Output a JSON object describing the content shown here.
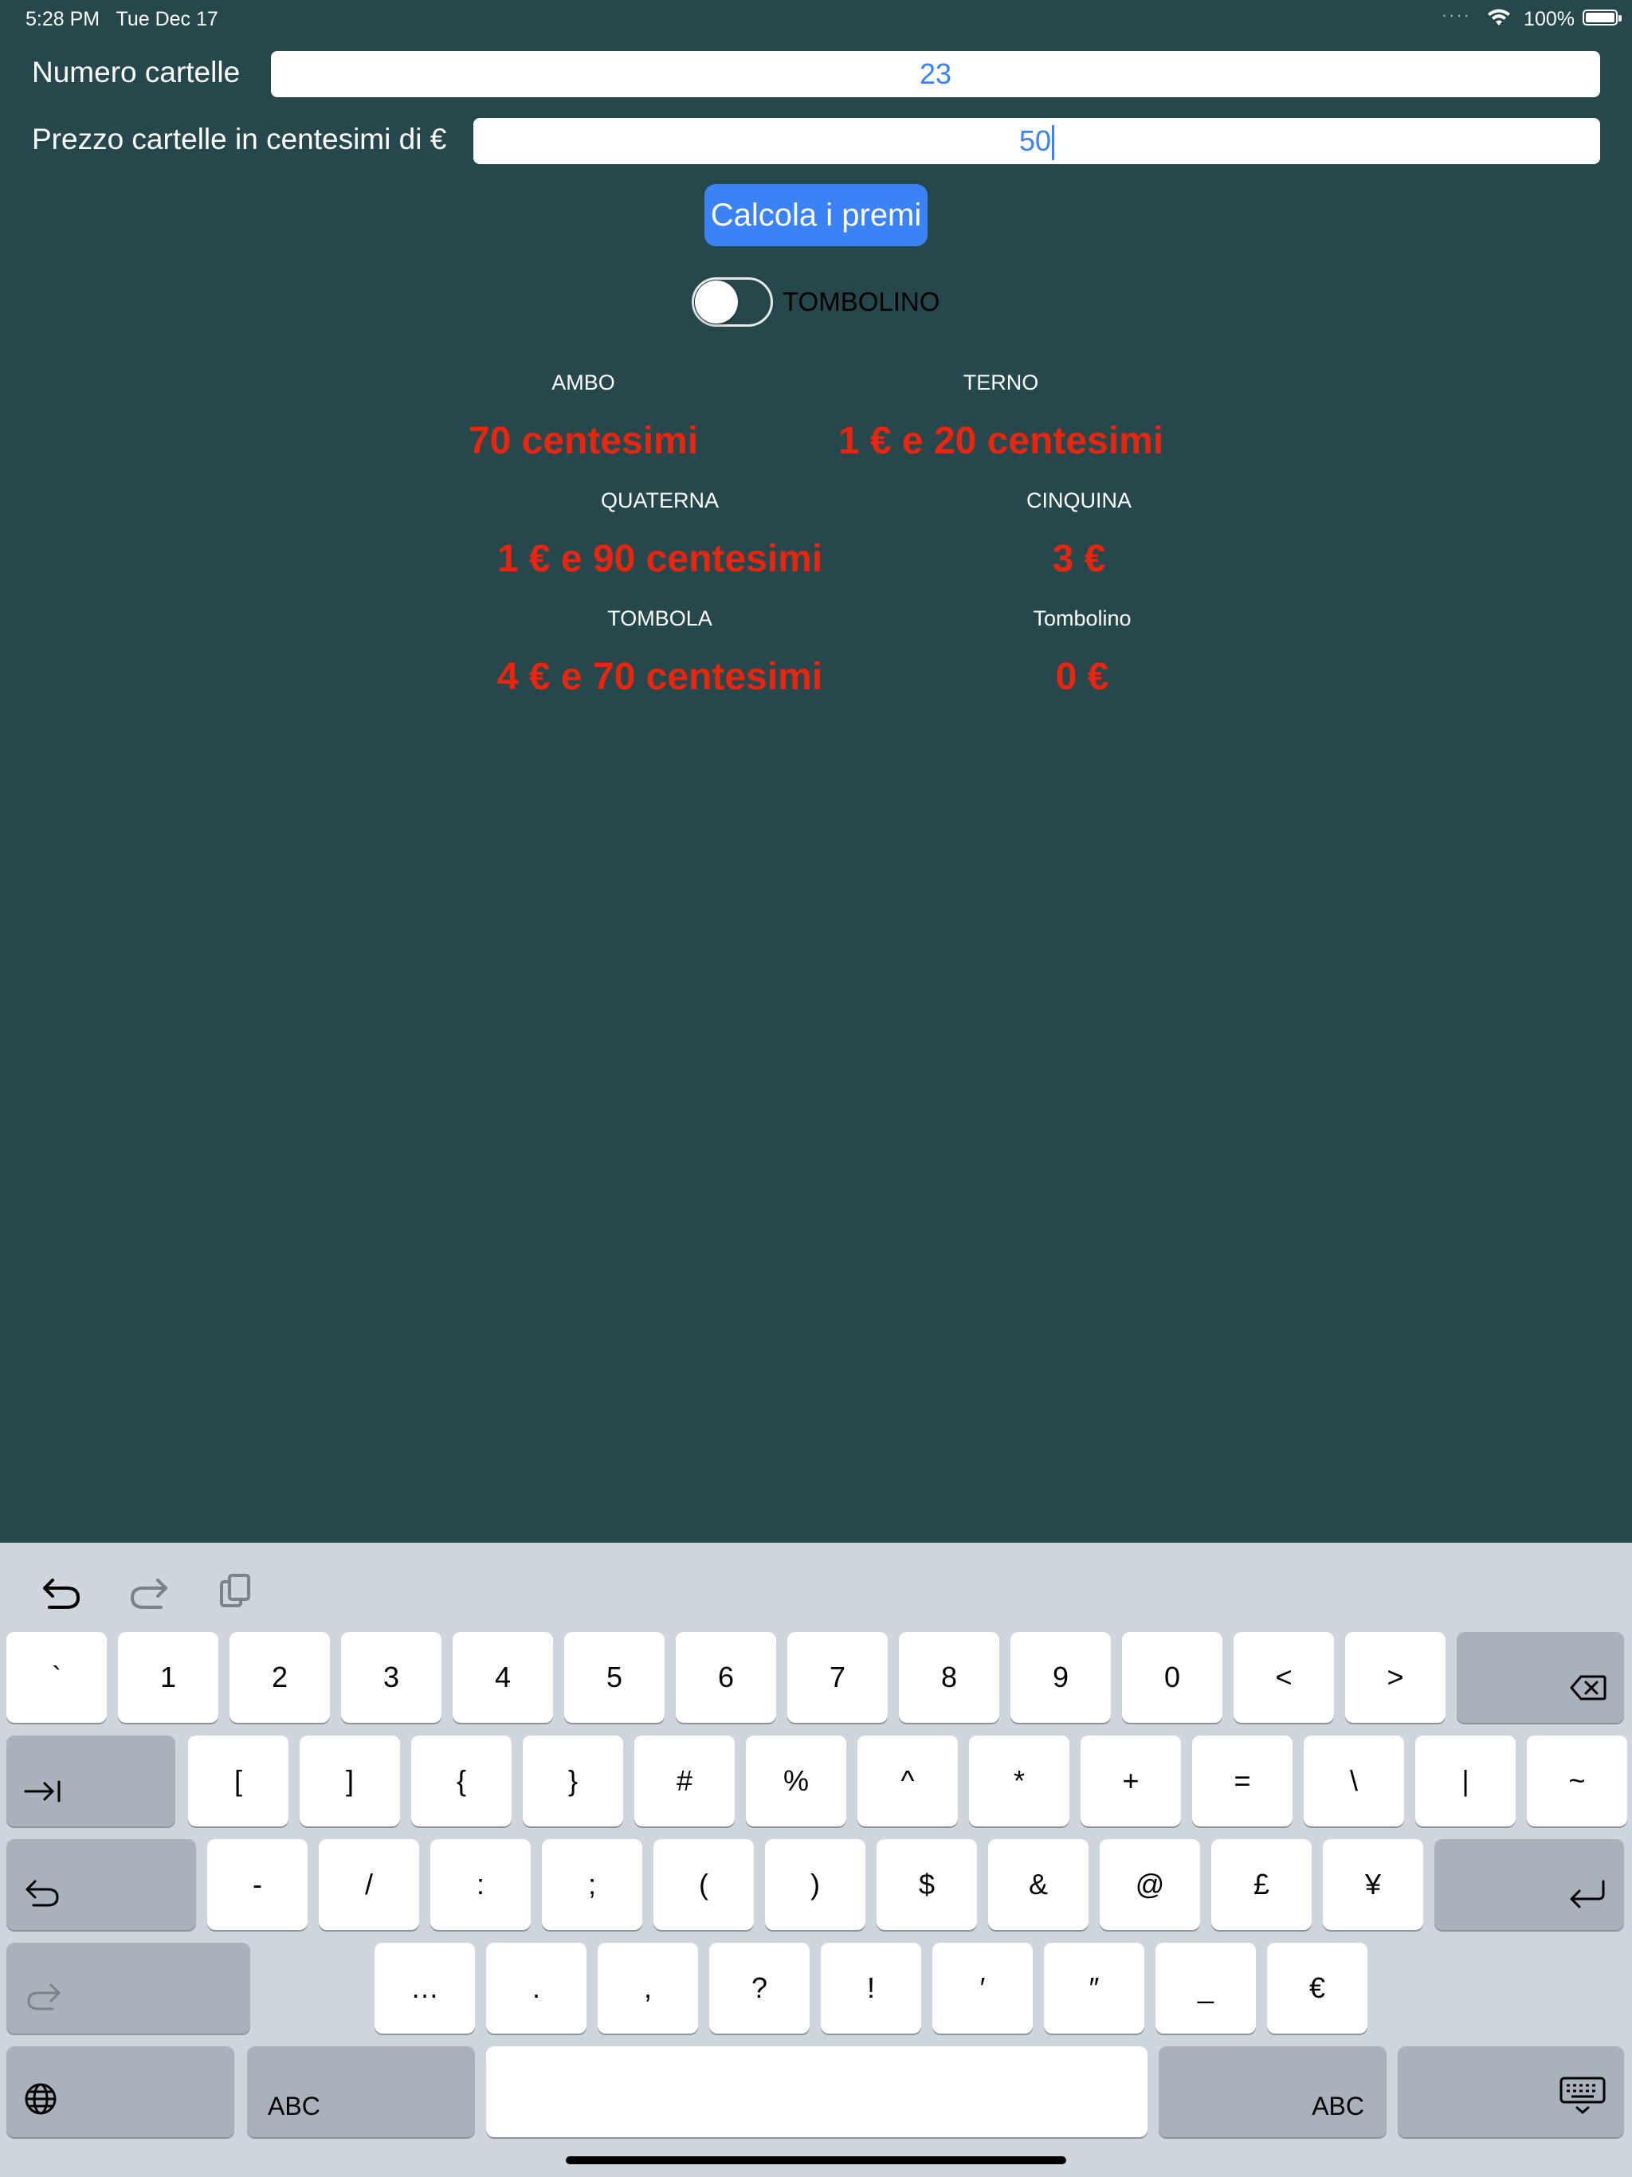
{
  "status": {
    "time": "5:28 PM",
    "date": "Tue Dec 17",
    "battery": "100%"
  },
  "form": {
    "numero_label": "Numero cartelle",
    "numero_value": "23",
    "prezzo_label": "Prezzo cartelle in centesimi di €",
    "prezzo_value": "50"
  },
  "calc_button": "Calcola i premi",
  "toggle": {
    "label": "TOMBOLINO",
    "on": false
  },
  "prizes": {
    "ambo": {
      "label": "AMBO",
      "value": "70 centesimi"
    },
    "terno": {
      "label": "TERNO",
      "value": "1 € e 20 centesimi"
    },
    "quaterna": {
      "label": "QUATERNA",
      "value": "1 € e 90 centesimi"
    },
    "cinquina": {
      "label": "CINQUINA",
      "value": "3 €"
    },
    "tombola": {
      "label": "TOMBOLA",
      "value": "4 € e 70 centesimi"
    },
    "tombolino": {
      "label": "Tombolino",
      "value": "0 €"
    }
  },
  "keyboard": {
    "row1": [
      "`",
      "1",
      "2",
      "3",
      "4",
      "5",
      "6",
      "7",
      "8",
      "9",
      "0",
      "<",
      ">"
    ],
    "row2": [
      "[",
      "]",
      "{",
      "}",
      "#",
      "%",
      "^",
      "*",
      "+",
      "=",
      "\\",
      "|",
      "~"
    ],
    "row3": [
      "-",
      "/",
      ":",
      ";",
      "(",
      ")",
      "$",
      "&",
      "@",
      "£",
      "¥"
    ],
    "row4": [
      "…",
      ".",
      ",",
      "?",
      "!",
      "′",
      "″",
      "_",
      "€"
    ],
    "abc_left": "ABC",
    "abc_right": "ABC"
  }
}
